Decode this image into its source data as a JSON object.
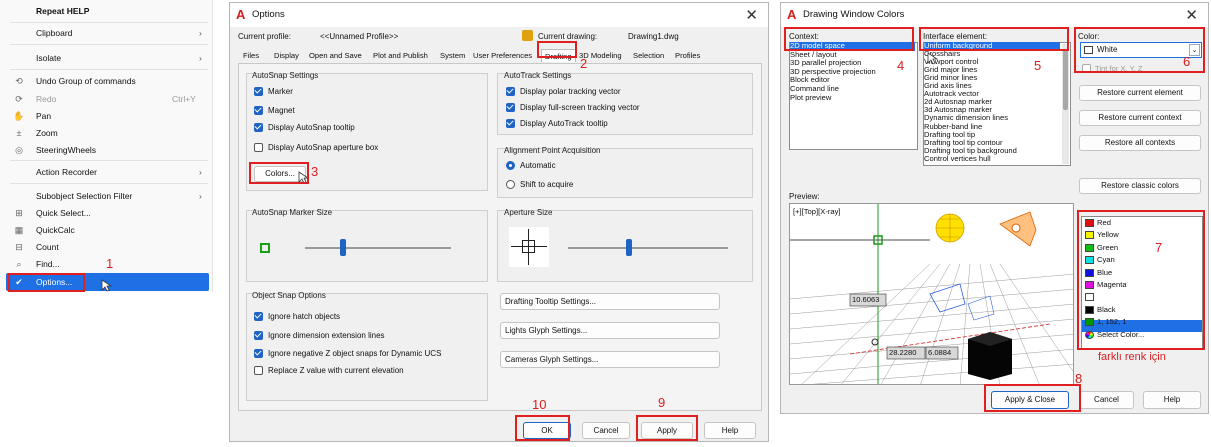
{
  "context_menu": {
    "items": [
      {
        "label": "Repeat HELP",
        "arrow": ""
      },
      {
        "label": "Clipboard",
        "arrow": "›"
      },
      {
        "label": "Isolate",
        "arrow": "›"
      },
      {
        "label": "Undo Group of commands",
        "icon": "⟲"
      },
      {
        "label": "Redo",
        "shortcut": "Ctrl+Y",
        "icon": "⟳"
      },
      {
        "label": "Pan",
        "icon": "✋"
      },
      {
        "label": "Zoom",
        "icon": "±"
      },
      {
        "label": "SteeringWheels",
        "icon": "◎"
      },
      {
        "label": "Action Recorder",
        "arrow": "›"
      },
      {
        "label": "Subobject Selection Filter",
        "arrow": "›"
      },
      {
        "label": "Quick Select...",
        "icon": "⊞"
      },
      {
        "label": "QuickCalc",
        "icon": "▦"
      },
      {
        "label": "Count",
        "icon": "⊟"
      },
      {
        "label": "Find...",
        "icon": "⌕"
      },
      {
        "label": "Options...",
        "icon": "✔"
      }
    ]
  },
  "options": {
    "title": "Options",
    "profile_label": "Current profile:",
    "profile_value": "<<Unnamed Profile>>",
    "drawing_label": "Current drawing:",
    "drawing_value": "Drawing1.dwg",
    "tabs": [
      "Files",
      "Display",
      "Open and Save",
      "Plot and Publish",
      "System",
      "User Preferences",
      "Drafting",
      "3D Modeling",
      "Selection",
      "Profiles"
    ],
    "autosnap_title": "AutoSnap Settings",
    "autosnap": [
      "Marker",
      "Magnet",
      "Display AutoSnap tooltip",
      "Display AutoSnap aperture box"
    ],
    "colors_btn": "Colors...",
    "autotrack_title": "AutoTrack Settings",
    "autotrack": [
      "Display polar tracking vector",
      "Display full-screen tracking vector",
      "Display AutoTrack tooltip"
    ],
    "align_title": "Alignment Point Acquisition",
    "align": [
      "Automatic",
      "Shift to acquire"
    ],
    "marker_size_title": "AutoSnap Marker Size",
    "aperture_title": "Aperture Size",
    "osnap_title": "Object Snap Options",
    "osnap": [
      "Ignore hatch objects",
      "Ignore dimension extension lines",
      "Ignore negative Z object snaps for Dynamic UCS",
      "Replace Z value with current elevation"
    ],
    "side_btns": [
      "Drafting Tooltip Settings...",
      "Lights Glyph Settings...",
      "Cameras Glyph Settings..."
    ],
    "ok": "OK",
    "cancel": "Cancel",
    "apply": "Apply",
    "help": "Help"
  },
  "dwc": {
    "title": "Drawing Window Colors",
    "context_label": "Context:",
    "contexts": [
      "2D model space",
      "Sheet / layout",
      "3D parallel projection",
      "3D perspective projection",
      "Block editor",
      "Command line",
      "Plot preview"
    ],
    "interface_label": "Interface element:",
    "elements": [
      "Uniform background",
      "Crosshairs",
      "Viewport control",
      "Grid major lines",
      "Grid minor lines",
      "Grid axis lines",
      "Autotrack vector",
      "2d Autosnap marker",
      "3d Autosnap marker",
      "Dynamic dimension lines",
      "Rubber-band line",
      "Drafting tool tip",
      "Drafting tool tip contour",
      "Drafting tool tip background",
      "Control vertices hull"
    ],
    "color_label": "Color:",
    "color_value": "White",
    "tint_label": "Tint for X, Y, Z",
    "restore_btns": [
      "Restore current element",
      "Restore current context",
      "Restore all contexts",
      "Restore classic colors"
    ],
    "preview_label": "Preview:",
    "viewport_label": "[+][Top][X-ray]",
    "dim1": "10.6063",
    "dim2": "28.2280",
    "dim3": "6.0884",
    "colors": [
      {
        "name": "Red",
        "hex": "#e01010"
      },
      {
        "name": "Yellow",
        "hex": "#f4f400"
      },
      {
        "name": "Green",
        "hex": "#10c010"
      },
      {
        "name": "Cyan",
        "hex": "#10e0e0"
      },
      {
        "name": "Blue",
        "hex": "#1010e0"
      },
      {
        "name": "Magenta",
        "hex": "#e010e0"
      },
      {
        "name": "White",
        "hex": "#ffffff"
      },
      {
        "name": "Black",
        "hex": "#000000"
      },
      {
        "name": "1, 152, 1",
        "hex": "#019801"
      },
      {
        "name": "Select Color...",
        "hex": "#ff8800"
      }
    ],
    "apply_close": "Apply & Close",
    "cancel": "Cancel",
    "help": "Help"
  },
  "annotations": {
    "steps": [
      "1",
      "3",
      "2",
      "4",
      "5",
      "6",
      "7",
      "8",
      "9",
      "10"
    ],
    "note": "farklı renk için"
  },
  "colors": {
    "accent": "#1f6fe5",
    "annotation": "#e02020",
    "autocad_red": "#d3201d"
  }
}
